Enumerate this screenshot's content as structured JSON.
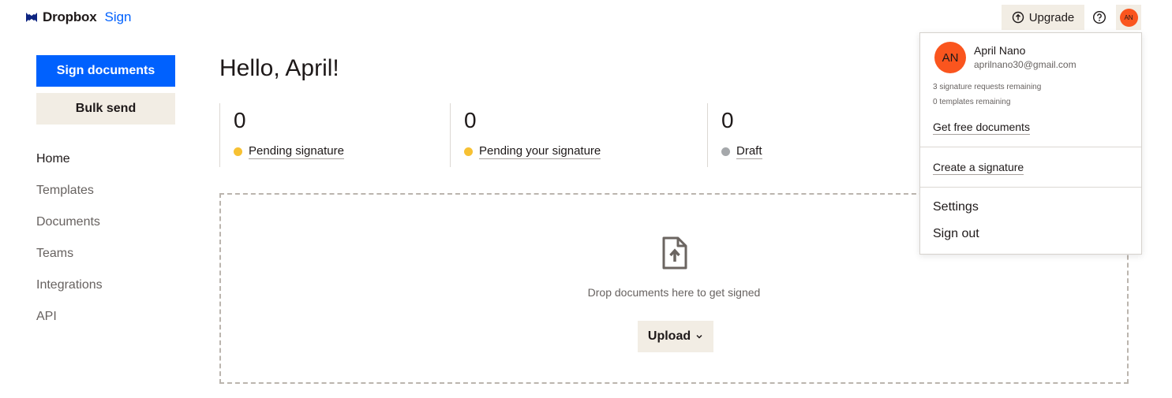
{
  "header": {
    "brand": "Dropbox",
    "product": "Sign",
    "upgrade_label": "Upgrade",
    "avatar_initials": "AN",
    "icons": {
      "logo": "dropbox-logo",
      "upgrade": "arrow-up-circle-icon",
      "help": "help-circle-icon"
    }
  },
  "sidebar": {
    "primary_button": "Sign documents",
    "secondary_button": "Bulk send",
    "items": [
      {
        "label": "Home"
      },
      {
        "label": "Templates"
      },
      {
        "label": "Documents"
      },
      {
        "label": "Teams"
      },
      {
        "label": "Integrations"
      },
      {
        "label": "API"
      }
    ]
  },
  "main": {
    "greeting": "Hello, April!",
    "stats": [
      {
        "count": "0",
        "label": "Pending signature",
        "color": "#f7c133"
      },
      {
        "count": "0",
        "label": "Pending your signature",
        "color": "#f7c133"
      },
      {
        "count": "0",
        "label": "Draft",
        "color": "#a5a8ab"
      }
    ],
    "dropzone": {
      "text": "Drop documents here to get signed",
      "upload_label": "Upload",
      "icon": "file-upload-icon"
    }
  },
  "account_menu": {
    "initials": "AN",
    "name": "April Nano",
    "email": "aprilnano30@gmail.com",
    "signature_requests": "3 signature requests remaining",
    "templates": "0 templates remaining",
    "get_free": "Get free documents",
    "create_signature": "Create a signature",
    "settings": "Settings",
    "sign_out": "Sign out"
  },
  "colors": {
    "accent": "#0061fe",
    "beige": "#f2ede4",
    "avatar": "#fa551e"
  }
}
